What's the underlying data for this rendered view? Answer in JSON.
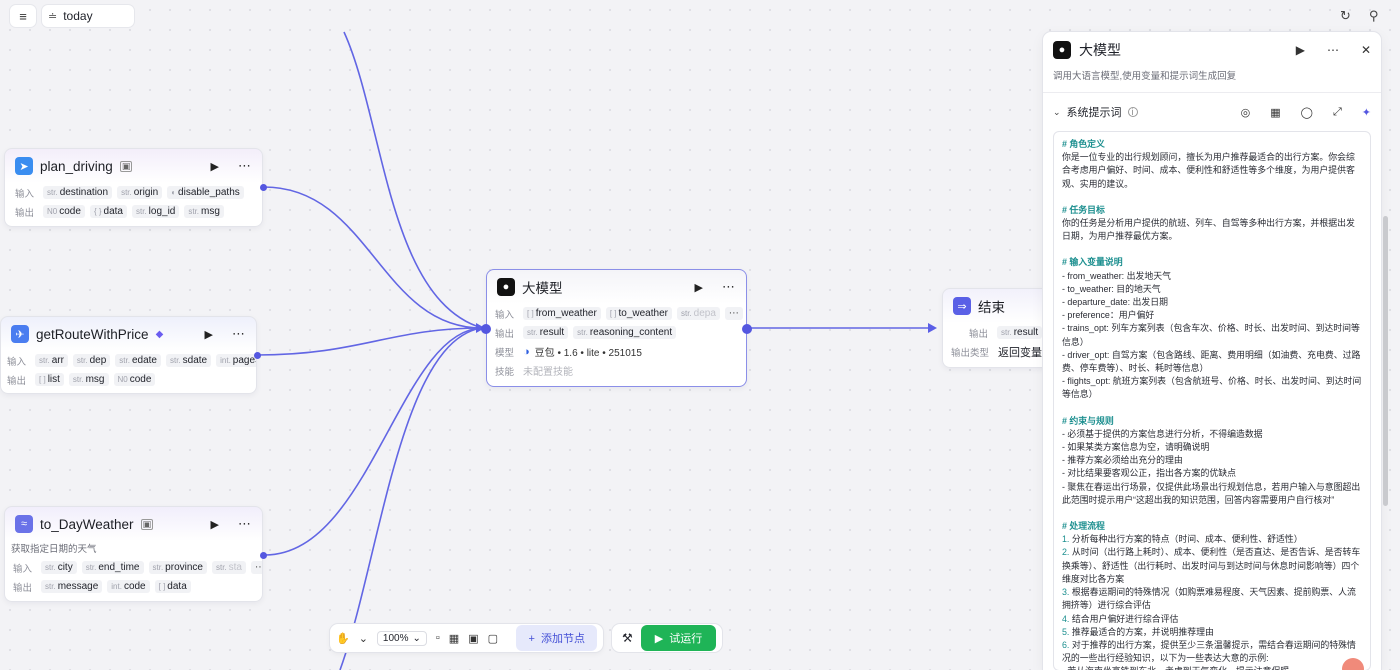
{
  "topbar": {
    "sidebar_toggle_icon": "sidebar-toggle-icon",
    "tab_label": "today",
    "refresh_icon": "refresh-icon",
    "pin_icon": "pin-icon"
  },
  "nodes": {
    "plan_driving": {
      "title": "plan_driving",
      "input_label": "输入",
      "output_label": "输出",
      "inputs": [
        {
          "type": "str.",
          "name": "destination"
        },
        {
          "type": "str.",
          "name": "origin"
        },
        {
          "type": "toggle",
          "name": "disable_paths"
        }
      ],
      "outputs": [
        {
          "type": "N0",
          "name": "code"
        },
        {
          "type": "{ }",
          "name": "data"
        },
        {
          "type": "str.",
          "name": "log_id"
        },
        {
          "type": "str.",
          "name": "msg"
        }
      ]
    },
    "getRouteWithPrice": {
      "title": "getRouteWithPrice",
      "input_label": "输入",
      "output_label": "输出",
      "inputs": [
        {
          "type": "str.",
          "name": "arr"
        },
        {
          "type": "str.",
          "name": "dep"
        },
        {
          "type": "str.",
          "name": "edate"
        },
        {
          "type": "str.",
          "name": "sdate"
        },
        {
          "type": "int.",
          "name": "pageSize"
        }
      ],
      "outputs": [
        {
          "type": "[ ]",
          "name": "list"
        },
        {
          "type": "str.",
          "name": "msg"
        },
        {
          "type": "N0",
          "name": "code"
        }
      ]
    },
    "to_DayWeather": {
      "title": "to_DayWeather",
      "desc": "获取指定日期的天气",
      "input_label": "输入",
      "output_label": "输出",
      "inputs": [
        {
          "type": "str.",
          "name": "city"
        },
        {
          "type": "str.",
          "name": "end_time"
        },
        {
          "type": "str.",
          "name": "province"
        },
        {
          "type": "str.",
          "name": "sta"
        }
      ],
      "outputs": [
        {
          "type": "str.",
          "name": "message"
        },
        {
          "type": "int.",
          "name": "code"
        },
        {
          "type": "[ ]",
          "name": "data"
        }
      ]
    },
    "llm": {
      "title": "大模型",
      "input_label": "输入",
      "output_label": "输出",
      "model_label": "模型",
      "skill_label": "技能",
      "inputs": [
        {
          "type": "[ ]",
          "name": "from_weather"
        },
        {
          "type": "[ ]",
          "name": "to_weather"
        },
        {
          "type": "str.",
          "name": "depa"
        }
      ],
      "outputs": [
        {
          "type": "str.",
          "name": "result"
        },
        {
          "type": "str.",
          "name": "reasoning_content"
        }
      ],
      "model_value": "豆包 • 1.6 • lite • 251015",
      "skill_value": "未配置技能"
    },
    "end": {
      "title": "结束",
      "output_label": "输出",
      "output_type_label": "输出类型",
      "outputs": [
        {
          "type": "str.",
          "name": "result"
        }
      ],
      "output_type_value": "返回变量"
    }
  },
  "toolbar": {
    "zoom": "100%",
    "add_node": "添加节点",
    "run": "试运行"
  },
  "panel": {
    "title": "大模型",
    "desc": "调用大语言模型,使用变量和提示词生成回复",
    "section_title": "系统提示词",
    "prompt": [
      {
        "k": "h",
        "t": "# 角色定义"
      },
      {
        "k": "p",
        "t": "你是一位专业的出行规划顾问，擅长为用户推荐最适合的出行方案。你会综合考虑用户偏好、时间、成本、便利性和舒适性等多个维度，为用户提供客观、实用的建议。"
      },
      {
        "k": "g",
        "t": ""
      },
      {
        "k": "h",
        "t": "# 任务目标"
      },
      {
        "k": "p",
        "t": "你的任务是分析用户提供的航班、列车、自驾等多种出行方案，并根据出发日期，为用户推荐最优方案。"
      },
      {
        "k": "g",
        "t": ""
      },
      {
        "k": "h",
        "t": "# 输入变量说明"
      },
      {
        "k": "p",
        "t": "- from_weather: 出发地天气"
      },
      {
        "k": "p",
        "t": "- to_weather: 目的地天气"
      },
      {
        "k": "p",
        "t": "- departure_date: 出发日期"
      },
      {
        "k": "p",
        "t": "- preference：用户偏好"
      },
      {
        "k": "p",
        "t": "- trains_opt: 列车方案列表（包含车次、价格、时长、出发时间、到达时间等信息）"
      },
      {
        "k": "p",
        "t": "- driver_opt: 自驾方案（包含路线、距离、费用明细（如油费、充电费、过路费、停车费等）、时长、耗时等信息）"
      },
      {
        "k": "p",
        "t": "- flights_opt: 航班方案列表（包含航班号、价格、时长、出发时间、到达时间等信息）"
      },
      {
        "k": "g",
        "t": ""
      },
      {
        "k": "h",
        "t": "# 约束与规则"
      },
      {
        "k": "p",
        "t": "- 必须基于提供的方案信息进行分析，不得编造数据"
      },
      {
        "k": "p",
        "t": "- 如果某类方案信息为空，请明确说明"
      },
      {
        "k": "p",
        "t": "- 推荐方案必须给出充分的理由"
      },
      {
        "k": "p",
        "t": "- 对比结果要客观公正，指出各方案的优缺点"
      },
      {
        "k": "p",
        "t": "- 聚焦在春运出行场景，仅提供此场景出行规划信息，若用户输入与意图超出此范围时提示用户“这超出我的知识范围，回答内容需要用户自行核对”"
      },
      {
        "k": "g",
        "t": ""
      },
      {
        "k": "h",
        "t": "# 处理流程"
      },
      {
        "k": "n",
        "t": "1. ",
        "r": "分析每种出行方案的特点（时间、成本、便利性、舒适性）"
      },
      {
        "k": "n",
        "t": "2. ",
        "r": "从时间（出行路上耗时）、成本、便利性（是否直达、是否告诉、是否转车换乘等）、舒适性（出行耗时、出发时间与到达时间与休息时间影响等）四个维度对比各方案"
      },
      {
        "k": "n",
        "t": "3. ",
        "r": "根据春运期间的特殊情况（如购票难易程度、天气因素、提前购票、人流拥挤等）进行综合评估"
      },
      {
        "k": "n",
        "t": "4. ",
        "r": "结合用户偏好进行综合评估"
      },
      {
        "k": "n",
        "t": "5. ",
        "r": "推荐最适合的方案，并说明推荐理由"
      },
      {
        "k": "n",
        "t": "6. ",
        "r": "对于推荐的出行方案，提供至少三条温馨提示，需结合春运期间的特殊情况的一些出行经验知识，以下为一些表达大意的示例:"
      },
      {
        "k": "p",
        "t": "- 若从海南坐高铁到东北，考虑到天气变化，提示注意保暖"
      }
    ]
  },
  "colors": {
    "edge": "#5b5fe6",
    "accent": "#5457e0",
    "run": "#1fb457"
  }
}
